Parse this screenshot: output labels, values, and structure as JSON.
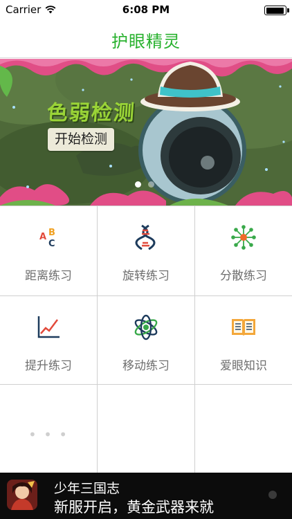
{
  "status_bar": {
    "carrier": "Carrier",
    "time": "6:08 PM",
    "icons": [
      "wifi-icon",
      "battery-icon"
    ]
  },
  "nav": {
    "title": "护眼精灵"
  },
  "banner": {
    "title": "色弱检测",
    "button_label": "开始检测",
    "page_count": 2,
    "current_page": 1
  },
  "grid": {
    "items": [
      {
        "label": "距离练习",
        "icon": "abc-letters-icon"
      },
      {
        "label": "旋转练习",
        "icon": "dna-icon"
      },
      {
        "label": "分散练习",
        "icon": "molecule-icon"
      },
      {
        "label": "提升练习",
        "icon": "line-chart-icon"
      },
      {
        "label": "移动练习",
        "icon": "atom-icon"
      },
      {
        "label": "爱眼知识",
        "icon": "book-icon"
      }
    ],
    "more_label": "• • •"
  },
  "ad": {
    "title": "少年三国志",
    "text": "新服开启，黄金武器来就"
  },
  "colors": {
    "accent": "#27b12d",
    "label_gray": "#6e6e6e",
    "banner_title": "#9ad437"
  }
}
